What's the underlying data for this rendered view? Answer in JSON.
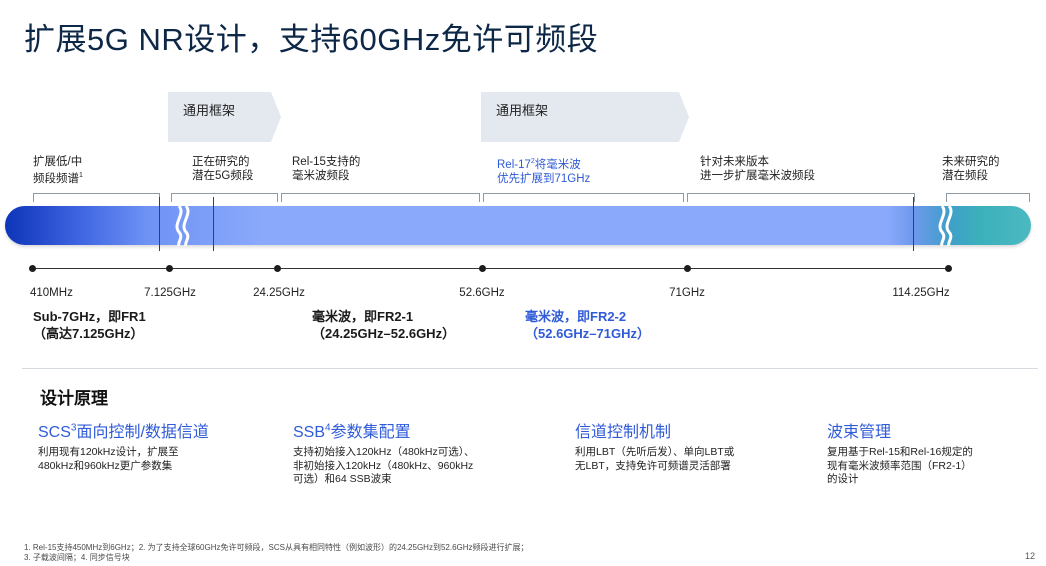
{
  "title": "扩展5G NR设计，支持60GHz免许可频段",
  "framework": {
    "label_left": "通用框架",
    "label_right": "通用框架"
  },
  "segments": [
    {
      "line1": "扩展低/中",
      "line2": "频段频谱",
      "sup": "1"
    },
    {
      "line1": "正在研究的",
      "line2": "潜在5G频段"
    },
    {
      "line1": "Rel-15支持的",
      "line2": "毫米波频段"
    },
    {
      "line1": "Rel-17",
      "sup": "2",
      "line1b": "将毫米波",
      "line2": "优先扩展到71GHz"
    },
    {
      "line1": "针对未来版本",
      "line2": "进一步扩展毫米波频段"
    },
    {
      "line1": "未来研究的",
      "line2": "潜在频段"
    }
  ],
  "ticks": [
    "410MHz",
    "7.125GHz",
    "24.25GHz",
    "52.6GHz",
    "71GHz",
    "114.25GHz"
  ],
  "bands": [
    {
      "name": "Sub-7GHz，即FR1",
      "range": "（高达7.125GHz）"
    },
    {
      "name": "毫米波，即FR2-1",
      "range": "（24.25GHz–52.6GHz）"
    },
    {
      "name": "毫米波，即FR2-2",
      "range": "（52.6GHz–71GHz）"
    }
  ],
  "design": {
    "title": "设计原理",
    "columns": [
      {
        "head_pre": "SCS",
        "head_sup": "3",
        "head_post": "面向控制/数据信道",
        "body": [
          "利用现有120kHz设计，扩展至",
          "480kHz和960kHz更广参数集"
        ]
      },
      {
        "head_pre": "SSB",
        "head_sup": "4",
        "head_post": "参数集配置",
        "body": [
          "支持初始接入120kHz（480kHz可选）、",
          "非初始接入120kHz（480kHz、960kHz",
          "可选）和64 SSB波束"
        ]
      },
      {
        "head_pre": "信道控制机制",
        "head_sup": "",
        "head_post": "",
        "body": [
          "利用LBT（先听后发）、单向LBT或",
          "无LBT，支持免许可频谱灵活部署"
        ]
      },
      {
        "head_pre": "波束管理",
        "head_sup": "",
        "head_post": "",
        "body": [
          "复用基于Rel-15和Rel-16规定的",
          "现有毫米波频率范围（FR2-1）",
          "的设计"
        ]
      }
    ]
  },
  "footnotes": {
    "line1": "1. Rel-15支持450MHz到6GHz；2. 为了支持全球60GHz免许可频段，SCS从具有相同特性（例如波形）的24.25GHz到52.6GHz频段进行扩展；",
    "line2": "3. 子载波间隔；4. 同步信号块"
  },
  "page_number": "12",
  "colors": {
    "accent": "#2f5bd8",
    "title": "#0d2747",
    "band_start": "#0e34b8",
    "band_mid": "#8aa9fb",
    "band_end": "#4cb9c1"
  }
}
